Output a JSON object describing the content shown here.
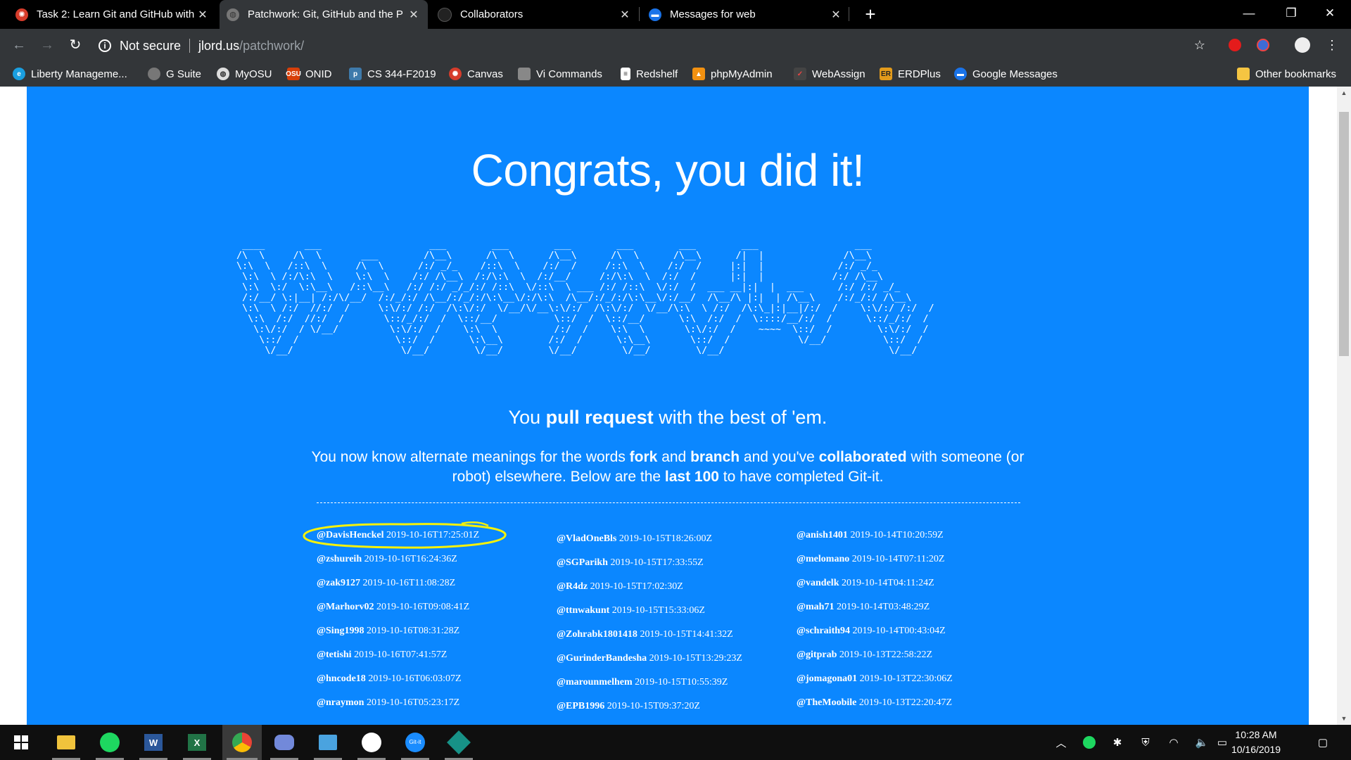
{
  "tabs": [
    {
      "title": "Task 2: Learn Git and GitHub with",
      "favicon": "canvas-icon",
      "close": "✕"
    },
    {
      "title": "Patchwork: Git, GitHub and the P",
      "favicon": "globe-icon",
      "close": "✕"
    },
    {
      "title": "Collaborators",
      "favicon": "github-icon",
      "close": "✕"
    },
    {
      "title": "Messages for web",
      "favicon": "messages-icon",
      "close": "✕"
    }
  ],
  "toolbar": {
    "security_label": "Not secure",
    "url_host": "jlord.us",
    "url_path": "/patchwork/"
  },
  "bookmarks": [
    {
      "label": "Liberty Manageme...",
      "icon": "ie-icon"
    },
    {
      "label": "G Suite",
      "icon": "gsuite-icon"
    },
    {
      "label": "MyOSU",
      "icon": "globe-icon"
    },
    {
      "label": "ONID",
      "icon": "osu-icon"
    },
    {
      "label": "CS 344-F2019",
      "icon": "piazza-icon"
    },
    {
      "label": "Canvas",
      "icon": "canvas-icon"
    },
    {
      "label": "Vi Commands",
      "icon": "vi-icon"
    },
    {
      "label": "Redshelf",
      "icon": "doc-icon"
    },
    {
      "label": "phpMyAdmin",
      "icon": "phpmyadmin-icon"
    },
    {
      "label": "WebAssign",
      "icon": "webassign-icon"
    },
    {
      "label": "ERDPlus",
      "icon": "erdplus-icon"
    },
    {
      "label": "Google Messages",
      "icon": "messages-icon"
    }
  ],
  "other_bookmarks": "Other bookmarks",
  "page": {
    "headline": "Congrats, you did it!",
    "tagline_pre": "You ",
    "tagline_bold": "pull request",
    "tagline_post": " with the best of 'em.",
    "para_1": "You now know alternate meanings for the words ",
    "para_fork": "fork",
    "para_2": " and ",
    "para_branch": "branch",
    "para_3": " and you've ",
    "para_collab": "collaborated",
    "para_4": " with someone (or robot) elsewhere. Below are the ",
    "para_last": "last 100",
    "para_5": " to have completed Git-it."
  },
  "completions": {
    "col1": [
      {
        "user": "@DavisHenckel",
        "time": "2019-10-16T17:25:01Z"
      },
      {
        "user": "@zshureih",
        "time": "2019-10-16T16:24:36Z"
      },
      {
        "user": "@zak9127",
        "time": "2019-10-16T11:08:28Z"
      },
      {
        "user": "@Marhorv02",
        "time": "2019-10-16T09:08:41Z"
      },
      {
        "user": "@Sing1998",
        "time": "2019-10-16T08:31:28Z"
      },
      {
        "user": "@tetishi",
        "time": "2019-10-16T07:41:57Z"
      },
      {
        "user": "@hncode18",
        "time": "2019-10-16T06:03:07Z"
      },
      {
        "user": "@nraymon",
        "time": "2019-10-16T05:23:17Z"
      }
    ],
    "col2": [
      {
        "user": "@VladOneBls",
        "time": "2019-10-15T18:26:00Z"
      },
      {
        "user": "@SGParikh",
        "time": "2019-10-15T17:33:55Z"
      },
      {
        "user": "@R4dz",
        "time": "2019-10-15T17:02:30Z"
      },
      {
        "user": "@ttnwakunt",
        "time": "2019-10-15T15:33:06Z"
      },
      {
        "user": "@Zohrabk1801418",
        "time": "2019-10-15T14:41:32Z"
      },
      {
        "user": "@GurinderBandesha",
        "time": "2019-10-15T13:29:23Z"
      },
      {
        "user": "@marounmelhem",
        "time": "2019-10-15T10:55:39Z"
      },
      {
        "user": "@EPB1996",
        "time": "2019-10-15T09:37:20Z"
      }
    ],
    "col3": [
      {
        "user": "@anish1401",
        "time": "2019-10-14T10:20:59Z"
      },
      {
        "user": "@melomano",
        "time": "2019-10-14T07:11:20Z"
      },
      {
        "user": "@vandelk",
        "time": "2019-10-14T04:11:24Z"
      },
      {
        "user": "@mah71",
        "time": "2019-10-14T03:48:29Z"
      },
      {
        "user": "@schraith94",
        "time": "2019-10-14T00:43:04Z"
      },
      {
        "user": "@gitprab",
        "time": "2019-10-13T22:58:22Z"
      },
      {
        "user": "@jomagona01",
        "time": "2019-10-13T22:30:06Z"
      },
      {
        "user": "@TheMoobile",
        "time": "2019-10-13T22:20:47Z"
      }
    ]
  },
  "taskbar": {
    "apps": [
      "windows-start-icon",
      "file-explorer-icon",
      "spotify-icon",
      "word-icon",
      "excel-icon",
      "chrome-icon",
      "discord-icon",
      "news-icon",
      "slack-icon",
      "git-it-icon",
      "gitkraken-icon"
    ],
    "time": "10:28 AM",
    "date": "10/16/2019"
  },
  "colors": {
    "page_bg": "#0b87ff",
    "highlight": "#f5f10a",
    "browser_dark": "#333639"
  }
}
